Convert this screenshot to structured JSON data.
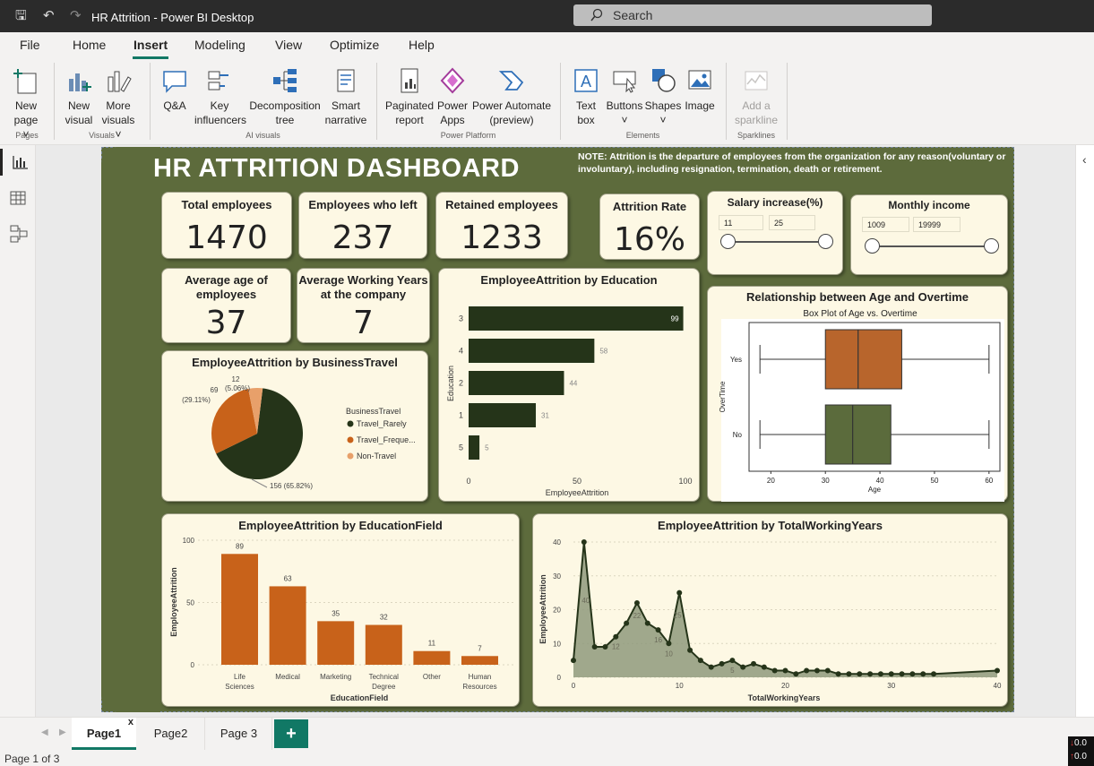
{
  "window": {
    "title": "HR Attrition - Power BI Desktop",
    "search_placeholder": "Search"
  },
  "menu": [
    "File",
    "Home",
    "Insert",
    "Modeling",
    "View",
    "Optimize",
    "Help"
  ],
  "ribbon": {
    "buttons": [
      {
        "label": "New page ˅"
      },
      {
        "label": "New visual"
      },
      {
        "label": "More visuals ˅"
      },
      {
        "label": "Q&A"
      },
      {
        "label": "Key influencers"
      },
      {
        "label": "Decomposition tree"
      },
      {
        "label": "Smart narrative"
      },
      {
        "label": "Paginated report"
      },
      {
        "label": "Power Apps"
      },
      {
        "label": "Power Automate (preview)"
      },
      {
        "label": "Text box"
      },
      {
        "label": "Buttons ˅"
      },
      {
        "label": "Shapes ˅"
      },
      {
        "label": "Image"
      },
      {
        "label": "Add a sparkline"
      }
    ],
    "groups": [
      "Pages",
      "Visuals",
      "AI visuals",
      "Power Platform",
      "Elements",
      "Sparklines"
    ]
  },
  "dashboard": {
    "title": "HR ATTRITION DASHBOARD",
    "note": "NOTE: Attrition is the departure of employees from the organization for any reason(voluntary or involuntary), including resignation, termination,  death or retirement."
  },
  "kpis": {
    "total": {
      "label": "Total employees",
      "value": "1470"
    },
    "left": {
      "label": "Employees who left",
      "value": "237"
    },
    "retained": {
      "label": "Retained employees",
      "value": "1233"
    },
    "rate": {
      "label": "Attrition Rate",
      "value": "16%"
    },
    "age": {
      "label": "Average age of employees",
      "value": "37"
    },
    "years": {
      "label": "Average Working Years at the company",
      "value": "7"
    }
  },
  "slicers": {
    "salary": {
      "title": "Salary increase(%)",
      "min": "11",
      "max": "25"
    },
    "income": {
      "title": "Monthly income",
      "min": "1009",
      "max": "19999"
    }
  },
  "visual_titles": {
    "education": "EmployeeAttrition by Education",
    "travel": "EmployeeAttrition by BusinessTravel",
    "boxplot": "Relationship between Age and Overtime",
    "field": "EmployeeAttrition by EducationField",
    "years": "EmployeeAttrition by TotalWorkingYears"
  },
  "colors": {
    "olive": "#5d6b3c",
    "dark_green": "#253419",
    "orange": "#c8621a",
    "light_orange": "#e8a06a",
    "card": "#fdf8e4",
    "box_orange": "#b8652c",
    "box_green": "#5b6b3c"
  },
  "chart_data": [
    {
      "type": "bar",
      "orientation": "horizontal",
      "title": "EmployeeAttrition by Education",
      "xlabel": "EmployeeAttrition",
      "ylabel": "Education",
      "categories": [
        "3",
        "4",
        "2",
        "1",
        "5"
      ],
      "values": [
        99,
        58,
        44,
        31,
        5
      ],
      "xlim": [
        0,
        100
      ],
      "xticks": [
        0,
        50,
        100
      ]
    },
    {
      "type": "pie",
      "title": "EmployeeAttrition by BusinessTravel",
      "legend_title": "BusinessTravel",
      "legend_entries": [
        "Travel_Rarely",
        "Travel_Freque...",
        "Non-Travel"
      ],
      "categories": [
        "Travel_Rarely",
        "Travel_Frequently",
        "Non-Travel"
      ],
      "values": [
        156,
        69,
        12
      ],
      "labels": [
        "156 (65.82%)",
        "69 (29.11%)",
        "12 (5.06%)"
      ]
    },
    {
      "type": "box",
      "title": "Box Plot of Age vs. Overtime",
      "xlabel": "Age",
      "ylabel": "OverTime",
      "categories": [
        "Yes",
        "No"
      ],
      "xticks": [
        20,
        30,
        40,
        50,
        60
      ],
      "xlim": [
        16,
        62
      ],
      "boxes": [
        {
          "name": "Yes",
          "min": 18,
          "q1": 30,
          "median": 36,
          "q3": 44,
          "max": 60
        },
        {
          "name": "No",
          "min": 18,
          "q1": 30,
          "median": 35,
          "q3": 42,
          "max": 60
        }
      ]
    },
    {
      "type": "bar",
      "title": "EmployeeAttrition by EducationField",
      "xlabel": "EducationField",
      "ylabel": "EmployeeAttrition",
      "categories": [
        "Life Sciences",
        "Medical",
        "Marketing",
        "Technical Degree",
        "Other",
        "Human Resources"
      ],
      "values": [
        89,
        63,
        35,
        32,
        11,
        7
      ],
      "ylim": [
        0,
        100
      ],
      "yticks": [
        0,
        50,
        100
      ]
    },
    {
      "type": "area",
      "title": "EmployeeAttrition by TotalWorkingYears",
      "xlabel": "TotalWorkingYears",
      "ylabel": "EmployeeAttrition",
      "x": [
        0,
        1,
        2,
        3,
        4,
        5,
        6,
        7,
        8,
        9,
        10,
        11,
        12,
        13,
        14,
        15,
        16,
        17,
        18,
        19,
        20,
        21,
        22,
        23,
        24,
        25,
        26,
        27,
        28,
        29,
        30,
        31,
        32,
        33,
        34,
        40
      ],
      "y": [
        5,
        40,
        9,
        9,
        12,
        16,
        22,
        16,
        14,
        10,
        25,
        8,
        5,
        3,
        4,
        5,
        3,
        4,
        3,
        2,
        2,
        1,
        2,
        2,
        2,
        1,
        1,
        1,
        1,
        1,
        1,
        1,
        1,
        1,
        1,
        2
      ],
      "point_labels": [
        {
          "x": 1,
          "y": 40,
          "label": "40"
        },
        {
          "x": 4,
          "y": 12,
          "label": "12"
        },
        {
          "x": 6,
          "y": 22,
          "label": "22"
        },
        {
          "x": 8,
          "y": 14,
          "label": "16"
        },
        {
          "x": 9,
          "y": 10,
          "label": "10"
        },
        {
          "x": 10,
          "y": 25,
          "label": "25"
        },
        {
          "x": 15,
          "y": 5,
          "label": "5"
        }
      ],
      "xlim": [
        0,
        40
      ],
      "ylim": [
        0,
        40
      ],
      "xticks": [
        0,
        10,
        20,
        30,
        40
      ],
      "yticks": [
        0,
        10,
        20,
        30,
        40
      ]
    }
  ],
  "pages": {
    "tabs": [
      "Page1",
      "Page2",
      "Page 3"
    ],
    "status": "Page 1 of 3"
  }
}
